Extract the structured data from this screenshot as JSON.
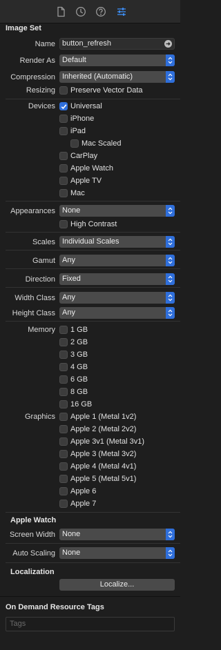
{
  "toolbar": {
    "icons": [
      "file-inspector-icon",
      "history-inspector-icon",
      "quick-help-icon",
      "attributes-inspector-icon"
    ],
    "active": "attributes-inspector-icon",
    "accent": "#3e92ff"
  },
  "image_set": {
    "title": "Image Set",
    "name_label": "Name",
    "name_value": "button_refresh",
    "render_as_label": "Render As",
    "render_as_value": "Default",
    "compression_label": "Compression",
    "compression_value": "Inherited (Automatic)",
    "resizing_label": "Resizing",
    "preserve_vector": "Preserve Vector Data",
    "devices_label": "Devices",
    "devices": [
      {
        "label": "Universal",
        "checked": true
      },
      {
        "label": "iPhone",
        "checked": false
      },
      {
        "label": "iPad",
        "checked": false
      },
      {
        "label": "Mac Scaled",
        "checked": false
      },
      {
        "label": "CarPlay",
        "checked": false
      },
      {
        "label": "Apple Watch",
        "checked": false
      },
      {
        "label": "Apple TV",
        "checked": false
      },
      {
        "label": "Mac",
        "checked": false
      }
    ],
    "appearances_label": "Appearances",
    "appearances_value": "None",
    "high_contrast": "High Contrast",
    "scales_label": "Scales",
    "scales_value": "Individual Scales",
    "gamut_label": "Gamut",
    "gamut_value": "Any",
    "direction_label": "Direction",
    "direction_value": "Fixed",
    "width_class_label": "Width Class",
    "width_class_value": "Any",
    "height_class_label": "Height Class",
    "height_class_value": "Any",
    "memory_label": "Memory",
    "memory": [
      "1 GB",
      "2 GB",
      "3 GB",
      "4 GB",
      "6 GB",
      "8 GB",
      "16 GB"
    ],
    "graphics_label": "Graphics",
    "graphics": [
      "Apple 1 (Metal 1v2)",
      "Apple 2 (Metal 2v2)",
      "Apple 3v1 (Metal 3v1)",
      "Apple 3 (Metal 3v2)",
      "Apple 4 (Metal 4v1)",
      "Apple 5 (Metal 5v1)",
      "Apple 6",
      "Apple 7"
    ]
  },
  "apple_watch": {
    "title": "Apple Watch",
    "screen_width_label": "Screen Width",
    "screen_width_value": "None",
    "auto_scaling_label": "Auto Scaling",
    "auto_scaling_value": "None"
  },
  "localization": {
    "title": "Localization",
    "button": "Localize..."
  },
  "on_demand": {
    "title": "On Demand Resource Tags",
    "placeholder": "Tags"
  }
}
